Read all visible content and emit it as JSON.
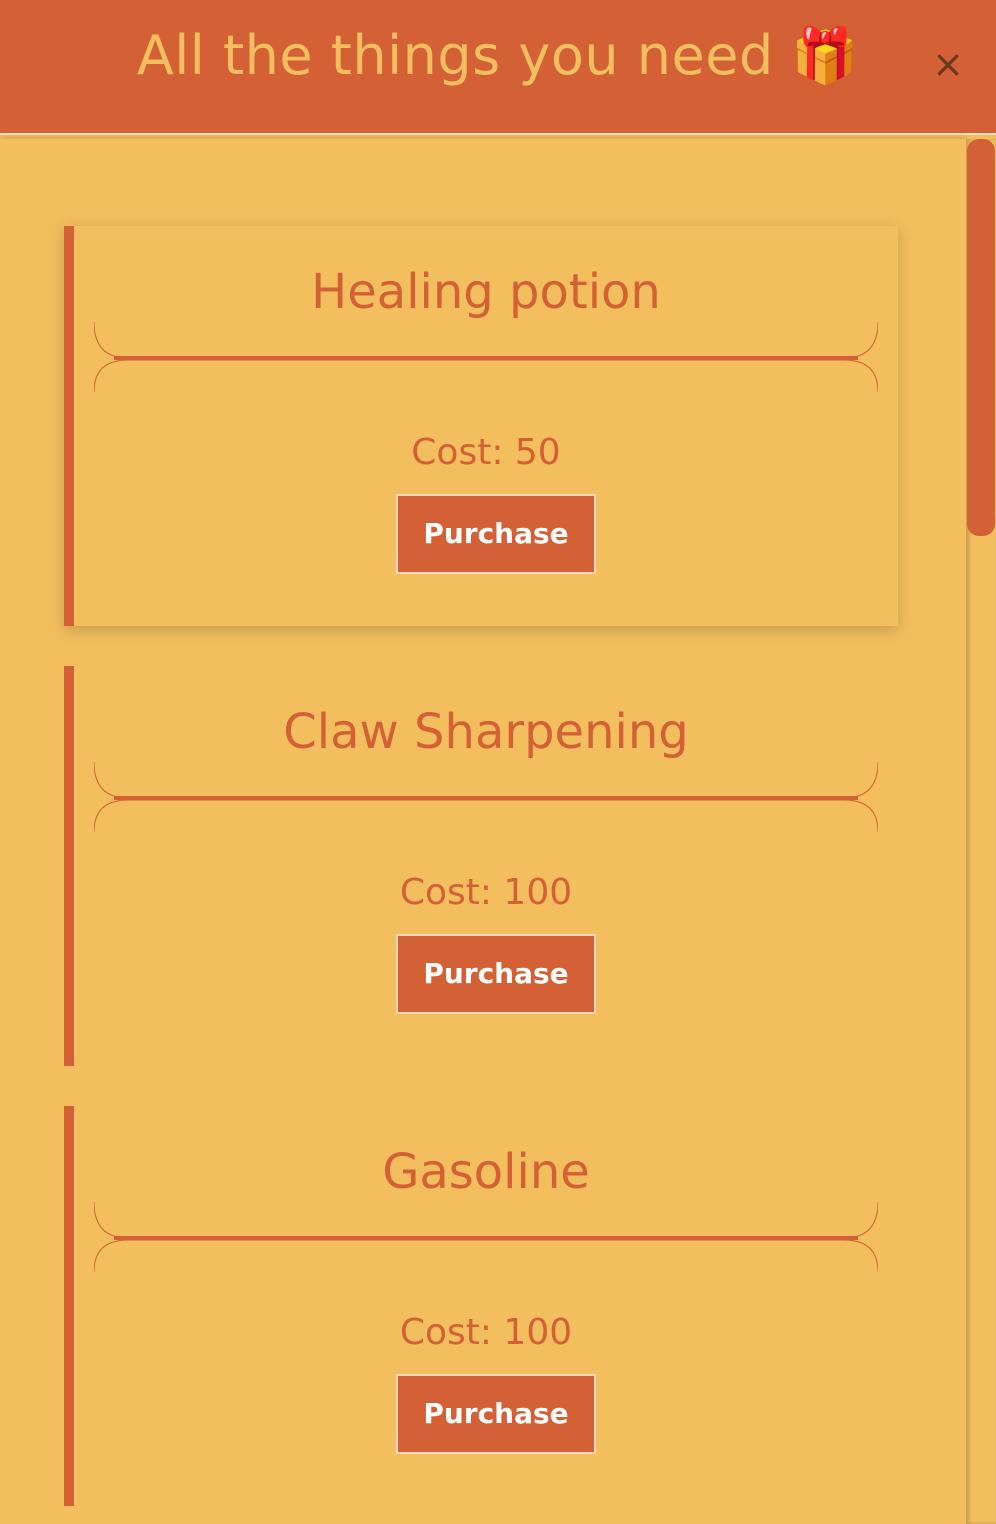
{
  "header": {
    "title": "All the things you need 🎁",
    "close_label": "×"
  },
  "items": [
    {
      "name": "Healing potion",
      "cost": "Cost: 50",
      "button": "Purchase"
    },
    {
      "name": "Claw Sharpening",
      "cost": "Cost: 100",
      "button": "Purchase"
    },
    {
      "name": "Gasoline",
      "cost": "Cost: 100",
      "button": "Purchase"
    }
  ],
  "colors": {
    "background": "#f2be5e",
    "accent": "#d46035",
    "button_text": "#ffffff"
  }
}
